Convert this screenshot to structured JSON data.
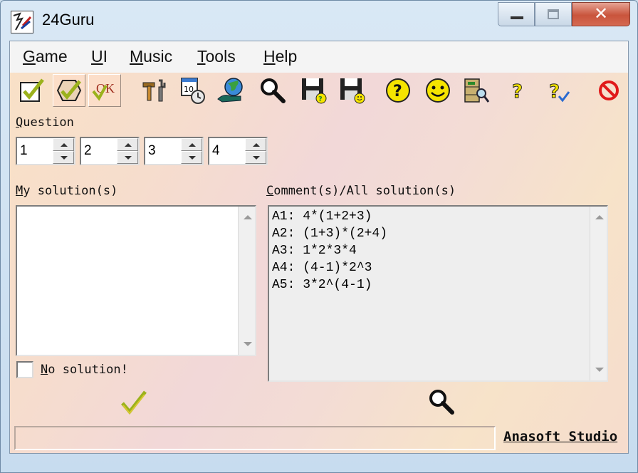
{
  "window": {
    "title": "24Guru",
    "app_icon": "24guru-app-icon",
    "close_symbol": "✕"
  },
  "menu": [
    {
      "label": "Game",
      "accesskey": "G"
    },
    {
      "label": "UI",
      "accesskey": "U"
    },
    {
      "label": "Music",
      "accesskey": "M"
    },
    {
      "label": "Tools",
      "accesskey": "T"
    },
    {
      "label": "Help",
      "accesskey": "H"
    }
  ],
  "toolbar": [
    {
      "icon": "check-box-icon"
    },
    {
      "icon": "check-circle-icon"
    },
    {
      "icon": "ok-check-icon",
      "text": "OK"
    },
    {
      "icon": "tools-icon"
    },
    {
      "icon": "timer-clock-icon",
      "text": "10"
    },
    {
      "icon": "globe-hand-icon"
    },
    {
      "icon": "magnifier-icon"
    },
    {
      "icon": "save-question-icon"
    },
    {
      "icon": "save-smiley-icon"
    },
    {
      "icon": "help-circle-icon"
    },
    {
      "icon": "smiley-icon"
    },
    {
      "icon": "cabinet-search-icon"
    },
    {
      "icon": "question-mark-icon"
    },
    {
      "icon": "question-check-icon"
    },
    {
      "icon": "stop-icon"
    }
  ],
  "question": {
    "label": "Question",
    "accesskey": "Q",
    "numbers": [
      "1",
      "2",
      "3",
      "4"
    ]
  },
  "my_solutions": {
    "label": "My solution(s)",
    "accesskey": "M",
    "text": ""
  },
  "comments": {
    "label": "Comment(s)/All solution(s)",
    "accesskey": "C",
    "lines": [
      "A1: 4*(1+2+3)",
      "A2: (1+3)*(2+4)",
      "A3: 1*2*3*4",
      "A4: (4-1)*2^3",
      "A5: 3*2^(4-1)"
    ]
  },
  "no_solution": {
    "label": "No solution!",
    "accesskey": "N",
    "checked": false
  },
  "actions": {
    "submit_icon": "checkmark-icon",
    "show_icon": "magnifier-icon"
  },
  "status": {
    "text": "",
    "brand": "Anasoft Studio"
  },
  "colors": {
    "accent_green": "#9bb21c",
    "yellow": "#f5e400",
    "stop_red": "#e01a1a"
  }
}
